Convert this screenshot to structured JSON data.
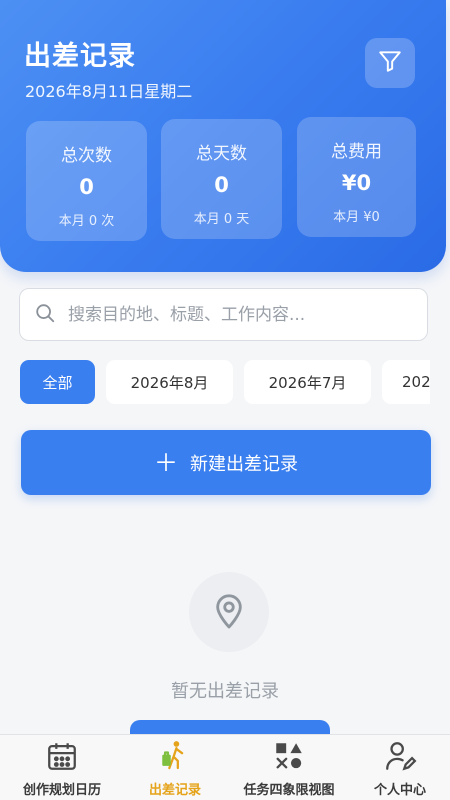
{
  "header": {
    "title": "出差记录",
    "date": "2026年8月11日星期二",
    "filter_icon": "filter-icon"
  },
  "stats": [
    {
      "label": "总次数",
      "value": "0",
      "sub": "本月 0 次"
    },
    {
      "label": "总天数",
      "value": "0",
      "sub": "本月 0 天"
    },
    {
      "label": "总费用",
      "value": "¥0",
      "sub": "本月 ¥0"
    }
  ],
  "search": {
    "placeholder": "搜索目的地、标题、工作内容...",
    "value": "",
    "icon": "search-icon"
  },
  "filters": [
    {
      "label": "全部",
      "active": true
    },
    {
      "label": "2026年8月",
      "active": false
    },
    {
      "label": "2026年7月",
      "active": false
    },
    {
      "label": "202",
      "active": false
    }
  ],
  "new_button": {
    "label": "新建出差记录",
    "icon": "plus-icon"
  },
  "empty_state": {
    "icon": "location-pin-icon",
    "text": "暂无出差记录"
  },
  "tabbar": [
    {
      "label": "创作规划日历",
      "icon": "calendar-icon",
      "active": false
    },
    {
      "label": "出差记录",
      "icon": "traveler-icon",
      "active": true
    },
    {
      "label": "任务四象限视图",
      "icon": "shapes-icon",
      "active": false
    },
    {
      "label": "个人中心",
      "icon": "user-edit-icon",
      "active": false
    }
  ],
  "colors": {
    "primary": "#3a7ff0",
    "header_gradient_start": "#4d90f3",
    "header_gradient_end": "#2a6be6",
    "active_tab": "#e5a31a",
    "background": "#f5f6f8"
  }
}
